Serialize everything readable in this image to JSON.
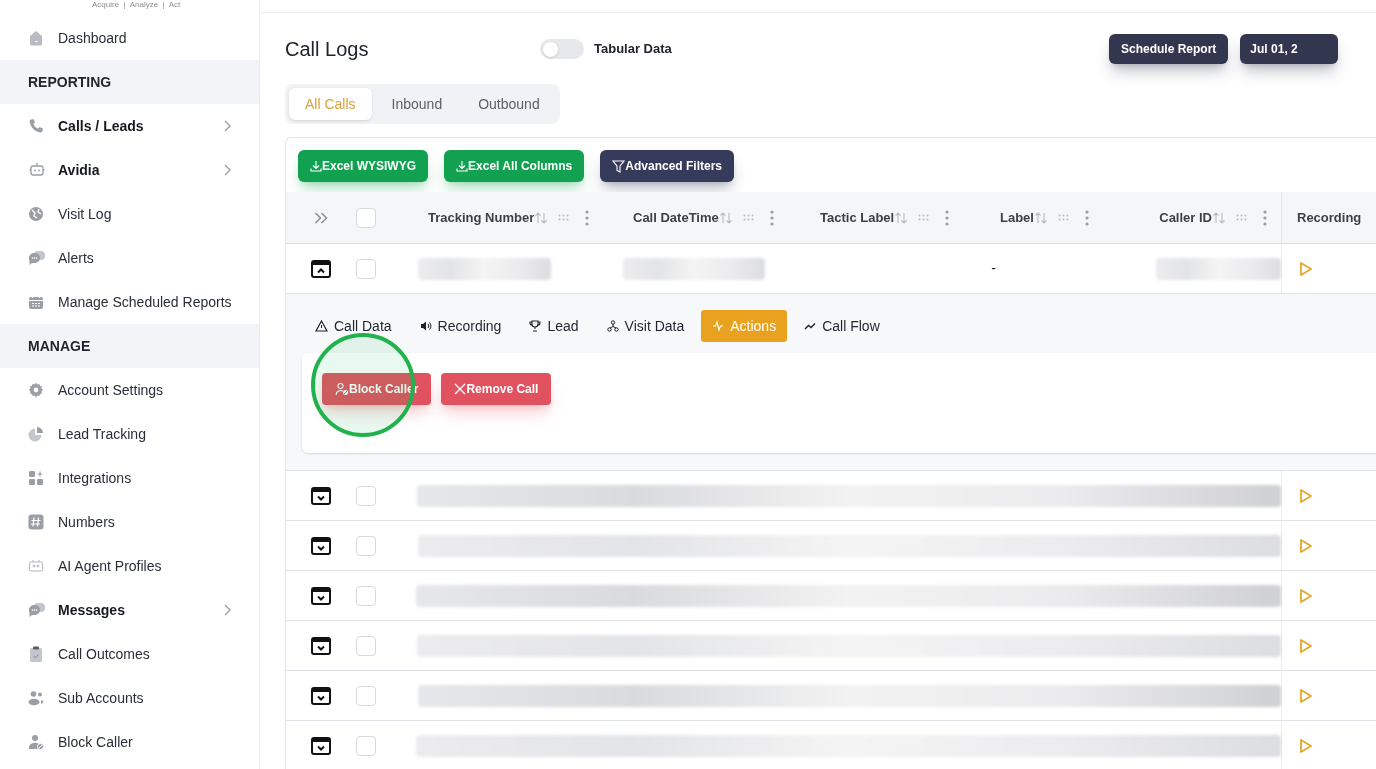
{
  "brand": {
    "tagline": "Acquire  |  Analyze  |  Act"
  },
  "sidebar": {
    "items": [
      {
        "kind": "link",
        "label": "Dashboard",
        "has_submenu": false
      },
      {
        "kind": "section",
        "label": "REPORTING"
      },
      {
        "kind": "link",
        "label": "Calls / Leads",
        "has_submenu": true
      },
      {
        "kind": "link",
        "label": "Avidia",
        "has_submenu": true
      },
      {
        "kind": "link",
        "label": "Visit Log",
        "has_submenu": false
      },
      {
        "kind": "link",
        "label": "Alerts",
        "has_submenu": false
      },
      {
        "kind": "link",
        "label": "Manage Scheduled Reports",
        "has_submenu": false
      },
      {
        "kind": "section",
        "label": "MANAGE"
      },
      {
        "kind": "link",
        "label": "Account Settings",
        "has_submenu": false
      },
      {
        "kind": "link",
        "label": "Lead Tracking",
        "has_submenu": false
      },
      {
        "kind": "link",
        "label": "Integrations",
        "has_submenu": false
      },
      {
        "kind": "link",
        "label": "Numbers",
        "has_submenu": false
      },
      {
        "kind": "link",
        "label": "AI Agent Profiles",
        "has_submenu": false
      },
      {
        "kind": "link",
        "label": "Messages",
        "has_submenu": true
      },
      {
        "kind": "link",
        "label": "Call Outcomes",
        "has_submenu": false
      },
      {
        "kind": "link",
        "label": "Sub Accounts",
        "has_submenu": false
      },
      {
        "kind": "link",
        "label": "Block Caller",
        "has_submenu": false
      }
    ]
  },
  "header": {
    "title": "Call Logs",
    "toggle": {
      "label": "Tabular Data",
      "on": false
    },
    "buttons": [
      "Schedule Report",
      "Jul 01, 2"
    ]
  },
  "tabs": [
    {
      "label": "All Calls",
      "selected": true
    },
    {
      "label": "Inbound",
      "selected": false
    },
    {
      "label": "Outbound",
      "selected": false
    }
  ],
  "toolbar": [
    {
      "kind": "export",
      "label": "Excel WYSIWYG"
    },
    {
      "kind": "export",
      "label": "Excel All Columns"
    },
    {
      "kind": "filter",
      "label": "Advanced Filters"
    }
  ],
  "table": {
    "select_all_checked": false,
    "columns": [
      "Tracking Number",
      "Call DateTime",
      "Tactic Label",
      "Label",
      "Caller ID",
      "Recording"
    ],
    "rows": [
      {
        "expanded": true,
        "checked": false,
        "label": "-",
        "detail": {
          "tabs": [
            {
              "label": "Call Data",
              "selected": false
            },
            {
              "label": "Recording",
              "selected": false
            },
            {
              "label": "Lead",
              "selected": false
            },
            {
              "label": "Visit Data",
              "selected": false
            },
            {
              "label": "Actions",
              "selected": true
            },
            {
              "label": "Call Flow",
              "selected": false
            }
          ],
          "actions": [
            {
              "kind": "block",
              "label": "Block Caller",
              "highlighted": true
            },
            {
              "kind": "remove",
              "label": "Remove Call",
              "highlighted": false
            }
          ]
        }
      },
      {
        "expanded": false,
        "checked": false
      },
      {
        "expanded": false,
        "checked": false
      },
      {
        "expanded": false,
        "checked": false
      },
      {
        "expanded": false,
        "checked": false
      },
      {
        "expanded": false,
        "checked": false
      },
      {
        "expanded": false,
        "checked": false
      }
    ]
  }
}
